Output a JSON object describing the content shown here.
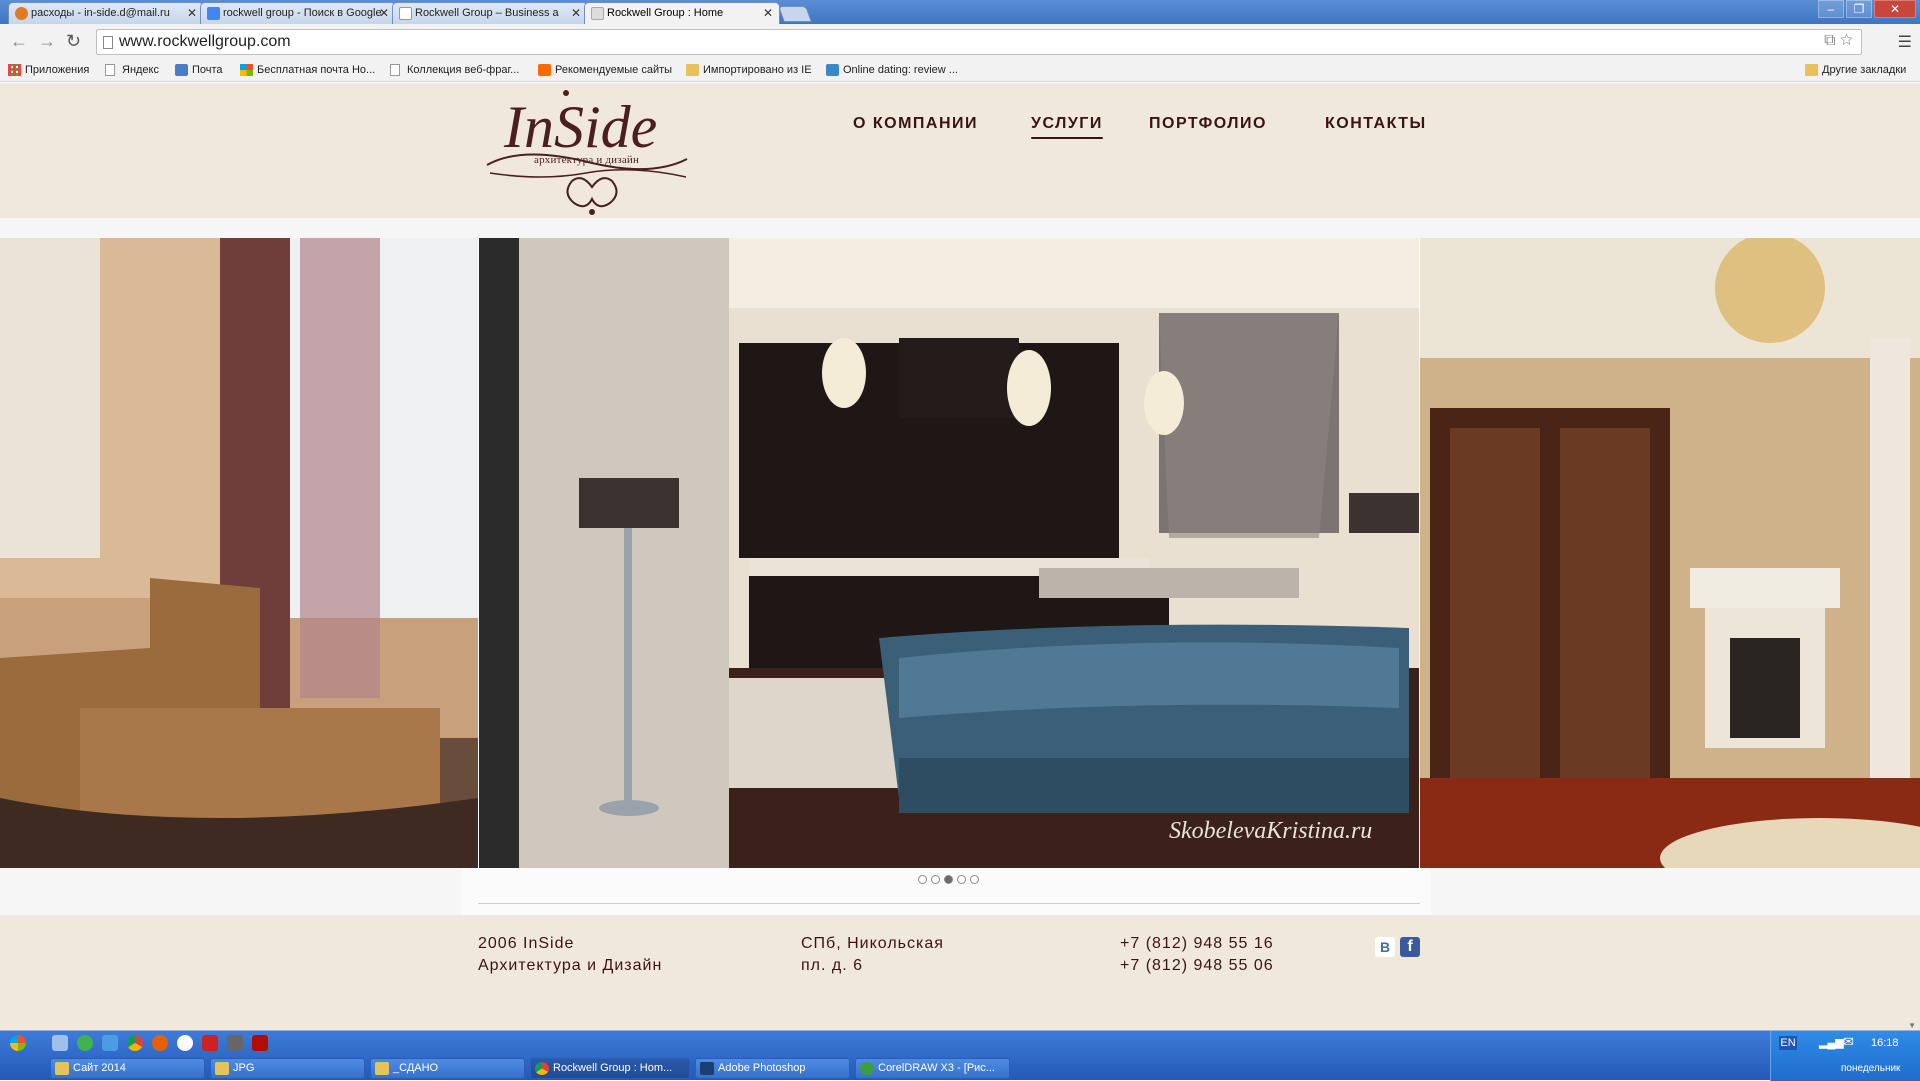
{
  "browser": {
    "tabs": [
      {
        "title": "расходы - in-side.d@mail.ru",
        "color": "#e07a25"
      },
      {
        "title": "rockwell group - Поиск в Google",
        "color": "#4285f4"
      },
      {
        "title": "Rockwell Group – Business a",
        "color": "#ffffff"
      },
      {
        "title": "Rockwell Group : Home",
        "color": "#dddddd"
      }
    ],
    "address": "www.rockwellgroup.com",
    "bookmarks": [
      {
        "label": "Приложения",
        "icon": "apps-icon"
      },
      {
        "label": "Яндекс",
        "icon": "page-icon"
      },
      {
        "label": "Почта",
        "icon": "mail-icon"
      },
      {
        "label": "Бесплатная почта Ho...",
        "icon": "windows-icon"
      },
      {
        "label": "Коллекция веб-фраг...",
        "icon": "page-icon"
      },
      {
        "label": "Рекомендуемые сайты",
        "icon": "recommended-icon"
      },
      {
        "label": "Импортировано из IE",
        "icon": "folder-icon"
      },
      {
        "label": "Online dating: review ...",
        "icon": "h-icon"
      }
    ],
    "other_bookmarks": "Другие закладки"
  },
  "site": {
    "logo": {
      "title": "InSide",
      "caption": "архитектура и дизайн"
    },
    "nav": [
      "О КОМПАНИИ",
      "УСЛУГИ",
      "ПОРТФОЛИО",
      "КОНТАКТЫ"
    ],
    "nav_active_index": 1,
    "slider": {
      "watermark": "SkobelevaKristina.ru",
      "dot_count": 5,
      "active_dot": 3
    },
    "footer": {
      "company_line1": "2006 InSide",
      "company_line2": "Архитектура и Дизайн",
      "address_line1": "СПб, Никольская",
      "address_line2": "пл. д. 6",
      "phone1": "+7 (812) 948 55 16",
      "phone2": "+7 (812) 948 55 06",
      "social": [
        "В",
        "f"
      ]
    }
  },
  "taskbar": {
    "windows": [
      {
        "label": "Сайт 2014",
        "icon": "folder-icon"
      },
      {
        "label": "JPG",
        "icon": "folder-icon"
      },
      {
        "label": "_СДАНО",
        "icon": "folder-icon"
      },
      {
        "label": "Rockwell Group : Hom...",
        "icon": "chrome-icon"
      },
      {
        "label": "Adobe Photoshop",
        "icon": "photoshop-icon"
      },
      {
        "label": "CorelDRAW X3 - [Рис...",
        "icon": "coreldraw-icon"
      }
    ],
    "active_window": 3,
    "language": "EN",
    "clock": "16:18",
    "day": "понедельник"
  }
}
